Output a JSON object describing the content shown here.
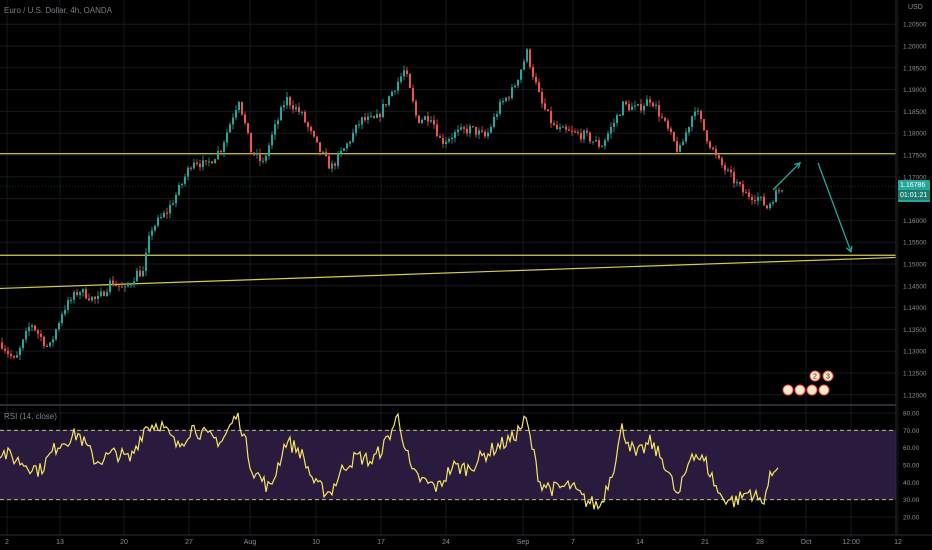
{
  "header": {
    "symbol_title": "Euro / U.S. Dollar, 4h, OANDA",
    "currency": "USD"
  },
  "price_panel": {
    "current_price": "1.16786",
    "countdown": "01:01:21",
    "current_price_color": "#26a69a"
  },
  "rsi_panel": {
    "label": "RSI (14, close)",
    "line_color": "#f5e663",
    "band_color": "#2a1a3d"
  },
  "colors": {
    "up": "#26a69a",
    "down": "#ef5350",
    "annotation": "#d4cf4a",
    "arrow": "#26a69a"
  },
  "event_markers": [
    "2",
    "3"
  ],
  "chart_data": [
    {
      "type": "candlestick",
      "title": "Euro / U.S. Dollar, 4h, OANDA",
      "x_tick_labels": [
        "2",
        "13",
        "20",
        "27",
        "Aug",
        "10",
        "17",
        "24",
        "Sep",
        "7",
        "14",
        "21",
        "28",
        "Oct",
        "12:00",
        "12"
      ],
      "y_tick_labels": [
        "1.20500",
        "1.20000",
        "1.19500",
        "1.19000",
        "1.18500",
        "1.18000",
        "1.17500",
        "1.17000",
        "1.16500",
        "1.16000",
        "1.15500",
        "1.15000",
        "1.14500",
        "1.14000",
        "1.13500",
        "1.13000",
        "1.12500",
        "1.12000"
      ],
      "ylim": [
        1.1183,
        1.2085
      ],
      "close_path": [
        [
          0,
          1.132
        ],
        [
          14,
          1.1275
        ],
        [
          30,
          1.1365
        ],
        [
          48,
          1.1305
        ],
        [
          62,
          1.1395
        ],
        [
          78,
          1.144
        ],
        [
          96,
          1.1415
        ],
        [
          110,
          1.146
        ],
        [
          124,
          1.144
        ],
        [
          136,
          1.148
        ],
        [
          142,
          1.148
        ],
        [
          150,
          1.158
        ],
        [
          166,
          1.162
        ],
        [
          180,
          1.168
        ],
        [
          192,
          1.174
        ],
        [
          205,
          1.1725
        ],
        [
          220,
          1.1765
        ],
        [
          238,
          1.188
        ],
        [
          250,
          1.176
        ],
        [
          262,
          1.173
        ],
        [
          272,
          1.18
        ],
        [
          285,
          1.188
        ],
        [
          300,
          1.1845
        ],
        [
          316,
          1.177
        ],
        [
          330,
          1.172
        ],
        [
          345,
          1.177
        ],
        [
          360,
          1.183
        ],
        [
          375,
          1.183
        ],
        [
          392,
          1.19
        ],
        [
          404,
          1.1945
        ],
        [
          416,
          1.183
        ],
        [
          430,
          1.184
        ],
        [
          440,
          1.178
        ],
        [
          455,
          1.18
        ],
        [
          470,
          1.181
        ],
        [
          485,
          1.179
        ],
        [
          498,
          1.186
        ],
        [
          512,
          1.19
        ],
        [
          526,
          1.1985
        ],
        [
          540,
          1.187
        ],
        [
          554,
          1.181
        ],
        [
          570,
          1.18
        ],
        [
          584,
          1.1795
        ],
        [
          600,
          1.177
        ],
        [
          612,
          1.182
        ],
        [
          622,
          1.1865
        ],
        [
          636,
          1.1855
        ],
        [
          650,
          1.188
        ],
        [
          664,
          1.182
        ],
        [
          678,
          1.1755
        ],
        [
          694,
          1.186
        ],
        [
          706,
          1.179
        ],
        [
          716,
          1.174
        ],
        [
          730,
          1.17
        ],
        [
          744,
          1.166
        ],
        [
          756,
          1.1655
        ],
        [
          766,
          1.163
        ],
        [
          774,
          1.166
        ],
        [
          782,
          1.1679
        ]
      ],
      "horizontal_lines": [
        {
          "name": "upper-resistance",
          "y": 1.1753
        },
        {
          "name": "lower-support",
          "y": 1.152
        }
      ],
      "trend_line": {
        "from": [
          0,
          1.1444
        ],
        "to": [
          896,
          1.1515
        ]
      },
      "current_price_line": 1.16786,
      "projection_arrows": [
        {
          "from": [
            773,
            1.167
          ],
          "to": [
            800,
            1.1732
          ]
        },
        {
          "from": [
            818,
            1.1732
          ],
          "to": [
            851,
            1.1528
          ]
        }
      ]
    },
    {
      "type": "line",
      "title": "RSI (14, close)",
      "y_tick_labels": [
        "80.00",
        "70.00",
        "60.00",
        "50.00",
        "40.00",
        "30.00",
        "20.00"
      ],
      "ylim": [
        17,
        82
      ],
      "bands": [
        70,
        30
      ],
      "rsi_path": [
        [
          0,
          58
        ],
        [
          20,
          52
        ],
        [
          40,
          47
        ],
        [
          58,
          62
        ],
        [
          78,
          68
        ],
        [
          96,
          52
        ],
        [
          116,
          57
        ],
        [
          130,
          53
        ],
        [
          145,
          72
        ],
        [
          160,
          74
        ],
        [
          178,
          60
        ],
        [
          192,
          72
        ],
        [
          208,
          66
        ],
        [
          222,
          64
        ],
        [
          238,
          80
        ],
        [
          252,
          48
        ],
        [
          270,
          36
        ],
        [
          286,
          64
        ],
        [
          300,
          58
        ],
        [
          316,
          38
        ],
        [
          330,
          34
        ],
        [
          345,
          50
        ],
        [
          358,
          55
        ],
        [
          372,
          52
        ],
        [
          385,
          62
        ],
        [
          398,
          78
        ],
        [
          412,
          45
        ],
        [
          425,
          40
        ],
        [
          438,
          37
        ],
        [
          452,
          49
        ],
        [
          468,
          48
        ],
        [
          485,
          56
        ],
        [
          498,
          61
        ],
        [
          512,
          65
        ],
        [
          526,
          76
        ],
        [
          540,
          40
        ],
        [
          554,
          36
        ],
        [
          570,
          38
        ],
        [
          584,
          30
        ],
        [
          600,
          26
        ],
        [
          614,
          50
        ],
        [
          622,
          71
        ],
        [
          636,
          55
        ],
        [
          650,
          63
        ],
        [
          664,
          52
        ],
        [
          678,
          31
        ],
        [
          692,
          58
        ],
        [
          706,
          51
        ],
        [
          720,
          32
        ],
        [
          735,
          29
        ],
        [
          750,
          35
        ],
        [
          762,
          28
        ],
        [
          770,
          42
        ],
        [
          778,
          52
        ]
      ]
    }
  ]
}
